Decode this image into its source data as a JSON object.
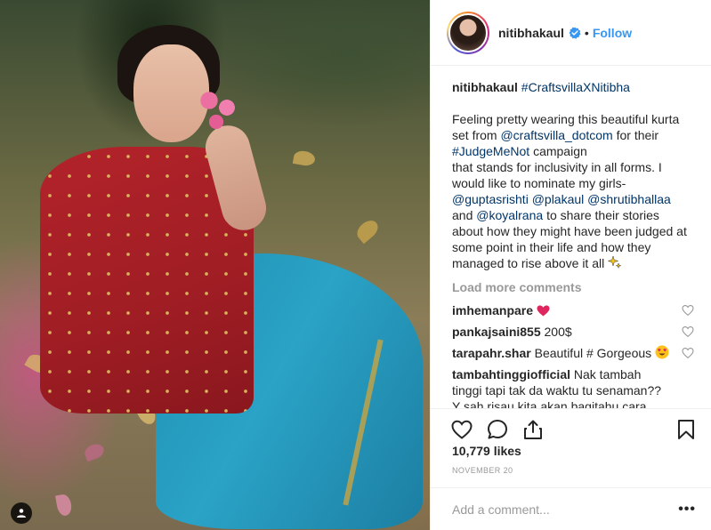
{
  "header": {
    "username": "nitibhakaul",
    "separator": "•",
    "follow_label": "Follow"
  },
  "caption": {
    "username": "nitibhakaul",
    "hashtag": "#CraftsvillaXNitibha",
    "lines": [
      "Feeling pretty wearing this beautiful kurta",
      "set from",
      "@craftsvilla_dotcom",
      "for their",
      "#JudgeMeNot",
      "campaign",
      "that stands for inclusivity in all forms. I",
      "would like to nominate my girls-",
      "@guptasrishti",
      "@plakaul",
      "@shrutibhallaa",
      "and",
      "@koyalrana",
      "to share their stories",
      "about how they might have been judged at",
      "some point in their life and how they",
      "managed to rise above it all"
    ]
  },
  "load_more": "Load more comments",
  "comments": [
    {
      "user": "imhemanpare",
      "text": ""
    },
    {
      "user": "pankajsaini855",
      "text": "200$"
    },
    {
      "user": "tarapahr.shar",
      "text": "Beautiful # Gorgeous"
    },
    {
      "user": "tambahtinggiofficial",
      "text": "Nak tambah",
      "line2": "tinggi tapi tak da waktu tu senaman??",
      "line3": "Y sah risau kita akan bagitahu cara"
    }
  ],
  "likes": "10,779 likes",
  "date": "NOVEMBER 20",
  "add_comment": {
    "placeholder": "Add a comment..."
  },
  "more_label": "•••",
  "icons": {
    "like": "heart-icon",
    "comment": "comment-icon",
    "share": "share-icon",
    "save": "bookmark-icon",
    "verified": "verified-badge-icon",
    "tag": "user-tag-icon"
  },
  "colors": {
    "link": "#003569",
    "follow": "#3897f0",
    "muted": "#999999",
    "verified": "#3897f0"
  }
}
